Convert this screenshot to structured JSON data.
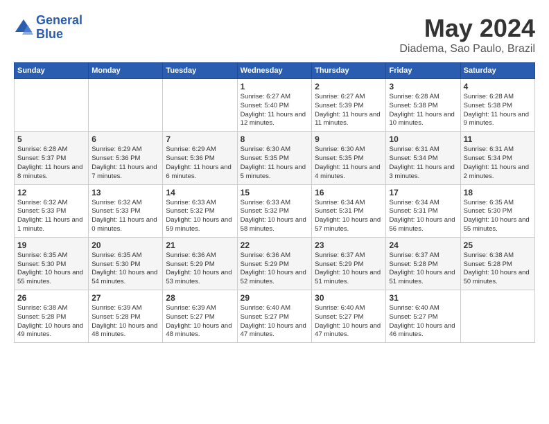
{
  "header": {
    "logo_line1": "General",
    "logo_line2": "Blue",
    "month": "May 2024",
    "location": "Diadema, Sao Paulo, Brazil"
  },
  "weekdays": [
    "Sunday",
    "Monday",
    "Tuesday",
    "Wednesday",
    "Thursday",
    "Friday",
    "Saturday"
  ],
  "weeks": [
    [
      {
        "day": "",
        "info": ""
      },
      {
        "day": "",
        "info": ""
      },
      {
        "day": "",
        "info": ""
      },
      {
        "day": "1",
        "info": "Sunrise: 6:27 AM\nSunset: 5:40 PM\nDaylight: 11 hours and 12 minutes."
      },
      {
        "day": "2",
        "info": "Sunrise: 6:27 AM\nSunset: 5:39 PM\nDaylight: 11 hours and 11 minutes."
      },
      {
        "day": "3",
        "info": "Sunrise: 6:28 AM\nSunset: 5:38 PM\nDaylight: 11 hours and 10 minutes."
      },
      {
        "day": "4",
        "info": "Sunrise: 6:28 AM\nSunset: 5:38 PM\nDaylight: 11 hours and 9 minutes."
      }
    ],
    [
      {
        "day": "5",
        "info": "Sunrise: 6:28 AM\nSunset: 5:37 PM\nDaylight: 11 hours and 8 minutes."
      },
      {
        "day": "6",
        "info": "Sunrise: 6:29 AM\nSunset: 5:36 PM\nDaylight: 11 hours and 7 minutes."
      },
      {
        "day": "7",
        "info": "Sunrise: 6:29 AM\nSunset: 5:36 PM\nDaylight: 11 hours and 6 minutes."
      },
      {
        "day": "8",
        "info": "Sunrise: 6:30 AM\nSunset: 5:35 PM\nDaylight: 11 hours and 5 minutes."
      },
      {
        "day": "9",
        "info": "Sunrise: 6:30 AM\nSunset: 5:35 PM\nDaylight: 11 hours and 4 minutes."
      },
      {
        "day": "10",
        "info": "Sunrise: 6:31 AM\nSunset: 5:34 PM\nDaylight: 11 hours and 3 minutes."
      },
      {
        "day": "11",
        "info": "Sunrise: 6:31 AM\nSunset: 5:34 PM\nDaylight: 11 hours and 2 minutes."
      }
    ],
    [
      {
        "day": "12",
        "info": "Sunrise: 6:32 AM\nSunset: 5:33 PM\nDaylight: 11 hours and 1 minute."
      },
      {
        "day": "13",
        "info": "Sunrise: 6:32 AM\nSunset: 5:33 PM\nDaylight: 11 hours and 0 minutes."
      },
      {
        "day": "14",
        "info": "Sunrise: 6:33 AM\nSunset: 5:32 PM\nDaylight: 10 hours and 59 minutes."
      },
      {
        "day": "15",
        "info": "Sunrise: 6:33 AM\nSunset: 5:32 PM\nDaylight: 10 hours and 58 minutes."
      },
      {
        "day": "16",
        "info": "Sunrise: 6:34 AM\nSunset: 5:31 PM\nDaylight: 10 hours and 57 minutes."
      },
      {
        "day": "17",
        "info": "Sunrise: 6:34 AM\nSunset: 5:31 PM\nDaylight: 10 hours and 56 minutes."
      },
      {
        "day": "18",
        "info": "Sunrise: 6:35 AM\nSunset: 5:30 PM\nDaylight: 10 hours and 55 minutes."
      }
    ],
    [
      {
        "day": "19",
        "info": "Sunrise: 6:35 AM\nSunset: 5:30 PM\nDaylight: 10 hours and 55 minutes."
      },
      {
        "day": "20",
        "info": "Sunrise: 6:35 AM\nSunset: 5:30 PM\nDaylight: 10 hours and 54 minutes."
      },
      {
        "day": "21",
        "info": "Sunrise: 6:36 AM\nSunset: 5:29 PM\nDaylight: 10 hours and 53 minutes."
      },
      {
        "day": "22",
        "info": "Sunrise: 6:36 AM\nSunset: 5:29 PM\nDaylight: 10 hours and 52 minutes."
      },
      {
        "day": "23",
        "info": "Sunrise: 6:37 AM\nSunset: 5:29 PM\nDaylight: 10 hours and 51 minutes."
      },
      {
        "day": "24",
        "info": "Sunrise: 6:37 AM\nSunset: 5:28 PM\nDaylight: 10 hours and 51 minutes."
      },
      {
        "day": "25",
        "info": "Sunrise: 6:38 AM\nSunset: 5:28 PM\nDaylight: 10 hours and 50 minutes."
      }
    ],
    [
      {
        "day": "26",
        "info": "Sunrise: 6:38 AM\nSunset: 5:28 PM\nDaylight: 10 hours and 49 minutes."
      },
      {
        "day": "27",
        "info": "Sunrise: 6:39 AM\nSunset: 5:28 PM\nDaylight: 10 hours and 48 minutes."
      },
      {
        "day": "28",
        "info": "Sunrise: 6:39 AM\nSunset: 5:27 PM\nDaylight: 10 hours and 48 minutes."
      },
      {
        "day": "29",
        "info": "Sunrise: 6:40 AM\nSunset: 5:27 PM\nDaylight: 10 hours and 47 minutes."
      },
      {
        "day": "30",
        "info": "Sunrise: 6:40 AM\nSunset: 5:27 PM\nDaylight: 10 hours and 47 minutes."
      },
      {
        "day": "31",
        "info": "Sunrise: 6:40 AM\nSunset: 5:27 PM\nDaylight: 10 hours and 46 minutes."
      },
      {
        "day": "",
        "info": ""
      }
    ]
  ]
}
